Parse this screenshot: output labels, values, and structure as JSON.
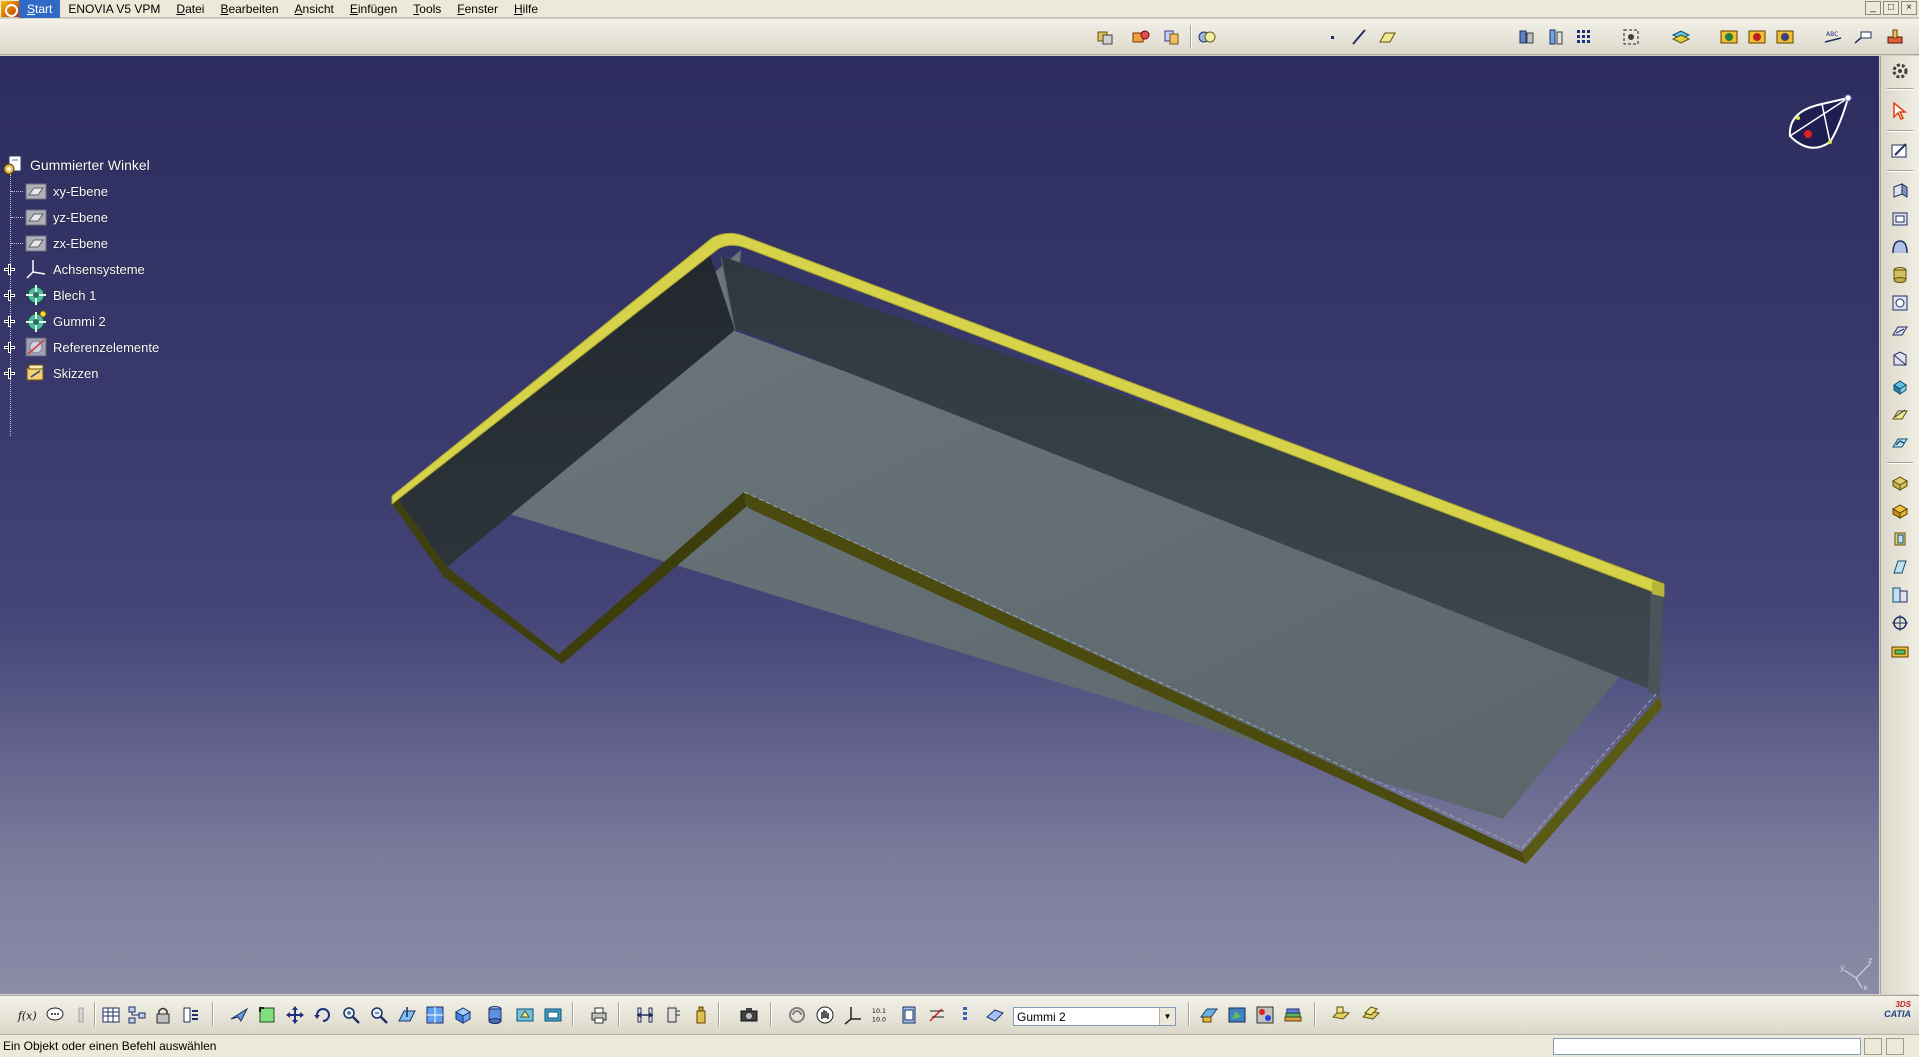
{
  "menu": {
    "items": [
      {
        "label": "Start",
        "accel": "S",
        "rest": "tart",
        "active": true
      },
      {
        "label": "ENOVIA V5 VPM",
        "accel": "",
        "rest": "ENOVIA V5 VPM",
        "active": false
      },
      {
        "label": "Datei",
        "accel": "D",
        "rest": "atei",
        "active": false
      },
      {
        "label": "Bearbeiten",
        "accel": "B",
        "rest": "earbeiten",
        "active": false
      },
      {
        "label": "Ansicht",
        "accel": "A",
        "rest": "nsicht",
        "active": false
      },
      {
        "label": "Einfügen",
        "accel": "E",
        "rest": "infügen",
        "active": false
      },
      {
        "label": "Tools",
        "accel": "T",
        "rest": "ools",
        "active": false
      },
      {
        "label": "Fenster",
        "accel": "F",
        "rest": "enster",
        "active": false
      },
      {
        "label": "Hilfe",
        "accel": "H",
        "rest": "ilfe",
        "active": false
      }
    ],
    "window_controls": [
      "_",
      "□",
      "×"
    ]
  },
  "spec_tree": {
    "root": "Gummierter Winkel",
    "nodes": [
      {
        "label": "xy-Ebene",
        "icon": "plane-icon",
        "expandable": false
      },
      {
        "label": "yz-Ebene",
        "icon": "plane-icon",
        "expandable": false
      },
      {
        "label": "zx-Ebene",
        "icon": "plane-icon",
        "expandable": false
      },
      {
        "label": "Achsensysteme",
        "icon": "axis-system-icon",
        "expandable": true
      },
      {
        "label": "Blech 1",
        "icon": "body-icon",
        "expandable": true
      },
      {
        "label": "Gummi 2",
        "icon": "body-icon",
        "expandable": true
      },
      {
        "label": "Referenzelemente",
        "icon": "reference-icon",
        "expandable": true
      },
      {
        "label": "Skizzen",
        "icon": "sketch-icon",
        "expandable": true
      }
    ]
  },
  "compass_axes": {
    "x": "x",
    "y": "y",
    "z": "z"
  },
  "bottom_toolbar": {
    "layer_value": "Gummi 2",
    "catia_logo": "CATIA",
    "ds_logo": "3DS"
  },
  "status": {
    "message": "Ein Objekt oder einen Befehl auswählen",
    "command_value": ""
  },
  "colors": {
    "rubber": "#d6d24a",
    "sheet_metal": "#5d6a70",
    "background_top": "#2d2c5e",
    "background_bottom": "#8c8ca8",
    "menu_active": "#3169c6"
  }
}
